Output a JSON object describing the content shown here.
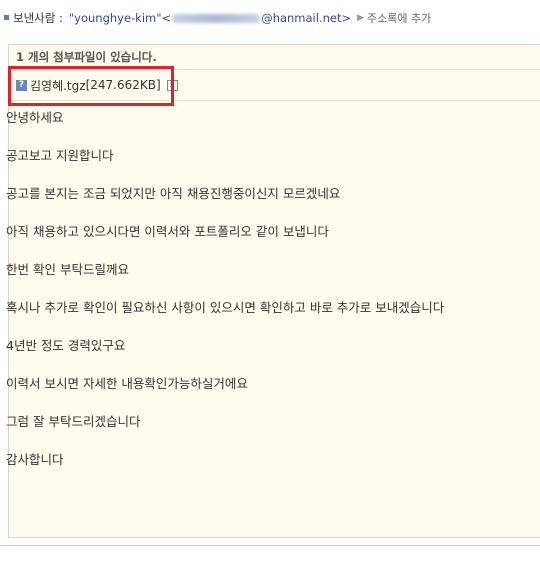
{
  "sender": {
    "label": "보낸사람 :",
    "name": "\"younghye-kim\"",
    "email_open": "<",
    "email_domain": "@hanmail.net>",
    "add_contact": "주소록에 추가"
  },
  "attachment": {
    "header": "1 개의 첨부파일이 있습니다.",
    "icon_char": "?",
    "file_name": "김영혜.tgz",
    "file_size": "[247.662KB]",
    "remove_char": "x"
  },
  "body": {
    "lines": [
      "안녕하세요",
      "공고보고 지원합니다",
      "공고를 본지는 조금 되었지만 아직 채용진행중이신지 모르겠네요",
      "아직 채용하고 있으시다면 이력서와 포트폴리오 같이 보냅니다",
      "한번 확인 부탁드릴께요",
      "혹시나 추가로 확인이 필요하신 사항이 있으시면 확인하고 바로 추가로 보내겠습니다",
      "4년반 정도 경력있구요",
      "이력서 보시면 자세한 내용확인가능하실거에요",
      "그럼 잘 부탁드리겠습니다",
      "감사합니다"
    ]
  },
  "colors": {
    "highlight": "#e02424",
    "panel_bg": "#fffbee",
    "link": "#2b4a9a"
  }
}
